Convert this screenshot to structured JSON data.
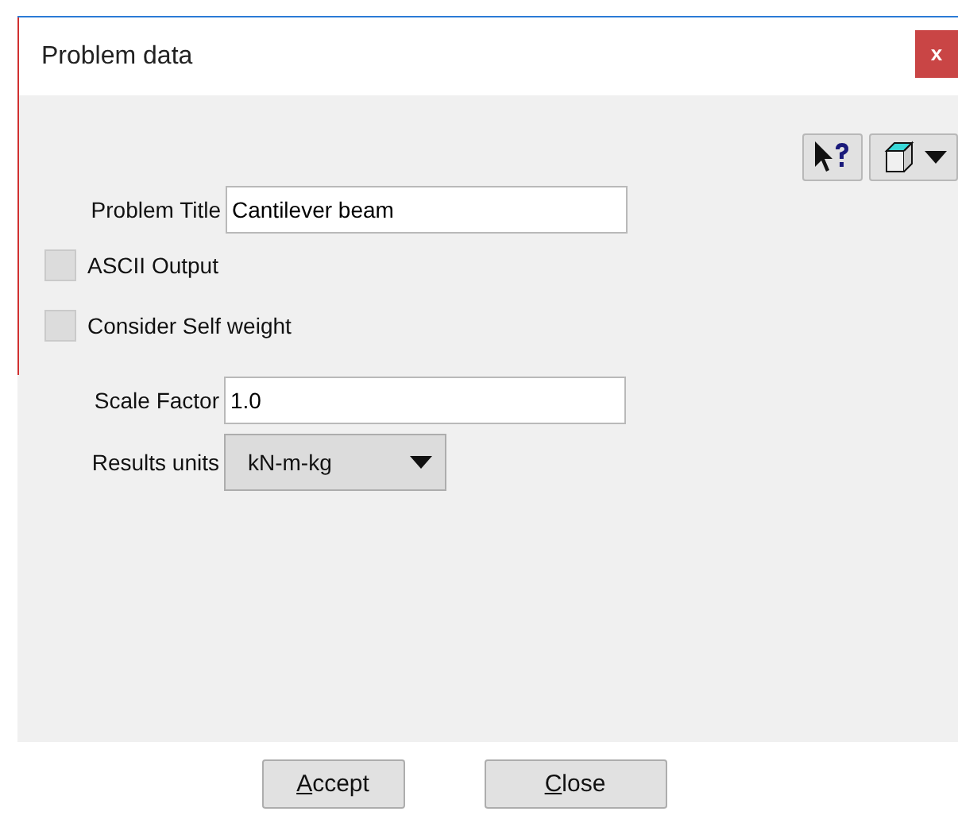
{
  "window": {
    "title": "Problem data",
    "close": "x"
  },
  "form": {
    "title_label": "Problem Title",
    "title_value": "Cantilever beam",
    "checkboxes": [
      {
        "label": "ASCII Output",
        "checked": false
      },
      {
        "label": "Consider Self weight",
        "checked": false
      }
    ],
    "scale_label": "Scale Factor",
    "scale_value": "1.0",
    "units_label": "Results units",
    "units_value": "kN-m-kg"
  },
  "buttons": [
    {
      "label": "Accept",
      "first_letter_underlined": true
    },
    {
      "label": "Close",
      "first_letter_underlined": true
    }
  ]
}
